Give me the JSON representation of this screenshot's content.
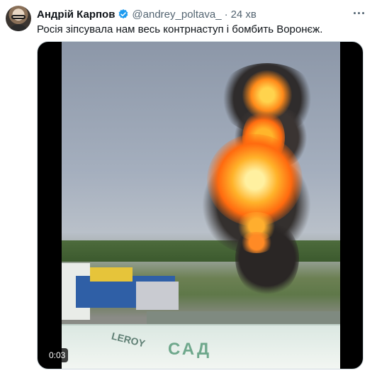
{
  "tweet": {
    "author_name": "Андрій Карпов",
    "handle": "@andrey_poltava_",
    "separator": "·",
    "time": "24 хв",
    "text": "Росія зіпсувала нам весь контрнаступ і бомбить Воронєж.",
    "verified_icon": "verified-badge-icon",
    "more_icon": "more-options-icon",
    "accent_color": "#1d9bf0"
  },
  "media": {
    "type": "video",
    "elapsed": "0:03",
    "visible_sign_text": "САД",
    "visible_logo_text": "LEROY"
  }
}
